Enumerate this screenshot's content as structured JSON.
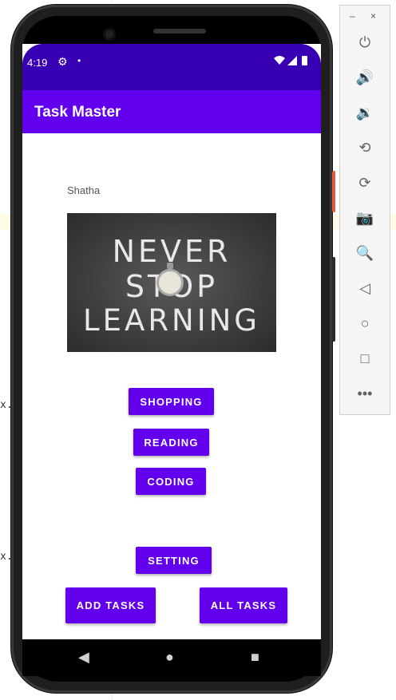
{
  "status_bar": {
    "time": "4:19",
    "settings_icon": "gear-icon",
    "dot": "•",
    "system_icons": "wifi-icon signal-icon battery-icon"
  },
  "app_bar": {
    "title": "Task Master"
  },
  "main": {
    "username": "Shatha",
    "hero_image": {
      "line1": "NEVER",
      "line2": "STOP",
      "line3": "LEARNING"
    },
    "buttons": {
      "shopping": "SHOPPING",
      "reading": "READING",
      "coding": "CODING",
      "setting": "SETTING",
      "add_tasks": "ADD TASKS",
      "all_tasks": "ALL TASKS"
    }
  },
  "nav_bar": {
    "back": "◀",
    "home": "●",
    "recents": "■"
  },
  "emulator_panel": {
    "minimize": "–",
    "close": "×",
    "icons": [
      "power-icon",
      "volume-up-icon",
      "volume-down-icon",
      "rotate-left-icon",
      "rotate-right-icon",
      "camera-icon",
      "zoom-icon",
      "back-icon",
      "home-icon",
      "overview-icon",
      "more-icon"
    ]
  },
  "ide_background": {
    "marker": "x."
  },
  "colors": {
    "primary": "#6200ee",
    "primary_dark": "#3700b3"
  }
}
